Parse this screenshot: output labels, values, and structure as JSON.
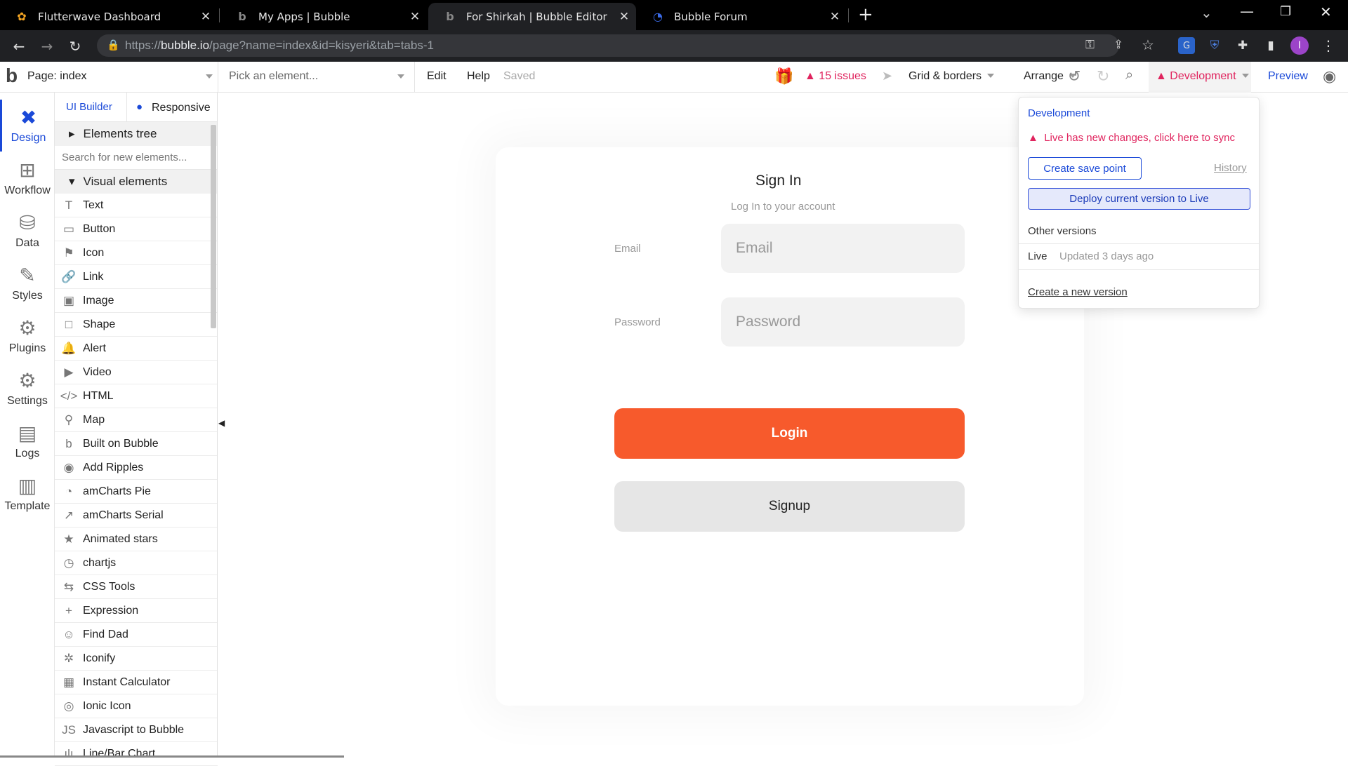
{
  "browser": {
    "tabs": [
      {
        "title": "Flutterwave Dashboard",
        "icon": "flutterwave-icon"
      },
      {
        "title": "My Apps | Bubble",
        "icon": "bubble-icon"
      },
      {
        "title": "For Shirkah | Bubble Editor",
        "icon": "bubble-icon",
        "active": true
      },
      {
        "title": "Bubble Forum",
        "icon": "bubble-forum-icon"
      }
    ],
    "url_prefix": "https://",
    "url_host": "bubble.io",
    "url_path": "/page?name=index&id=kisyeri&tab=tabs-1",
    "profile_initial": "I"
  },
  "topbar": {
    "logo": "b",
    "page_label": "Page: index",
    "element_picker": "Pick an element...",
    "edit": "Edit",
    "help": "Help",
    "saved": "Saved",
    "issues": "15 issues",
    "grid": "Grid & borders",
    "arrange": "Arrange",
    "environment": "Development",
    "preview": "Preview"
  },
  "rail": [
    {
      "label": "Design",
      "icon": "design-icon"
    },
    {
      "label": "Workflow",
      "icon": "workflow-icon"
    },
    {
      "label": "Data",
      "icon": "database-icon"
    },
    {
      "label": "Styles",
      "icon": "brush-icon"
    },
    {
      "label": "Plugins",
      "icon": "plugin-icon"
    },
    {
      "label": "Settings",
      "icon": "gear-icon"
    },
    {
      "label": "Logs",
      "icon": "document-icon"
    },
    {
      "label": "Template",
      "icon": "template-icon"
    }
  ],
  "panel": {
    "tab_ui": "UI Builder",
    "tab_responsive": "Responsive",
    "elements_tree": "Elements tree",
    "search_placeholder": "Search for new elements...",
    "visual_elements": "Visual elements",
    "items": [
      {
        "label": "Text",
        "glyph": "T"
      },
      {
        "label": "Button",
        "glyph": "▭"
      },
      {
        "label": "Icon",
        "glyph": "⚑"
      },
      {
        "label": "Link",
        "glyph": "🔗"
      },
      {
        "label": "Image",
        "glyph": "▣"
      },
      {
        "label": "Shape",
        "glyph": "□"
      },
      {
        "label": "Alert",
        "glyph": "🔔"
      },
      {
        "label": "Video",
        "glyph": "▶"
      },
      {
        "label": "HTML",
        "glyph": "</>"
      },
      {
        "label": "Map",
        "glyph": "⚲"
      },
      {
        "label": "Built on Bubble",
        "glyph": "b"
      },
      {
        "label": "Add Ripples",
        "glyph": "◉"
      },
      {
        "label": "amCharts Pie",
        "glyph": "◔"
      },
      {
        "label": "amCharts Serial",
        "glyph": "↗"
      },
      {
        "label": "Animated stars",
        "glyph": "★"
      },
      {
        "label": "chartjs",
        "glyph": "◷"
      },
      {
        "label": "CSS Tools",
        "glyph": "⇆"
      },
      {
        "label": "Expression",
        "glyph": "+"
      },
      {
        "label": "Find Dad",
        "glyph": "☺"
      },
      {
        "label": "Iconify",
        "glyph": "✲"
      },
      {
        "label": "Instant Calculator",
        "glyph": "▦"
      },
      {
        "label": "Ionic Icon",
        "glyph": "◎"
      },
      {
        "label": "Javascript to Bubble",
        "glyph": "JS"
      },
      {
        "label": "Line/Bar Chart",
        "glyph": "ılı"
      }
    ]
  },
  "canvas": {
    "title": "Sign In",
    "subtitle": "Log In to your account",
    "email_label": "Email",
    "email_placeholder": "Email",
    "password_label": "Password",
    "password_placeholder": "Password",
    "login": "Login",
    "signup": "Signup"
  },
  "dev_popup": {
    "title": "Development",
    "warning": "Live has new changes, click here to sync",
    "save_point": "Create save point",
    "history": "History",
    "deploy": "Deploy current version to Live",
    "other_versions": "Other versions",
    "live_label": "Live",
    "live_updated": "Updated 3 days ago",
    "new_version": "Create a new version"
  },
  "colors": {
    "accent": "#1a49d8",
    "login": "#f75a2c",
    "warning": "#e0245e"
  }
}
